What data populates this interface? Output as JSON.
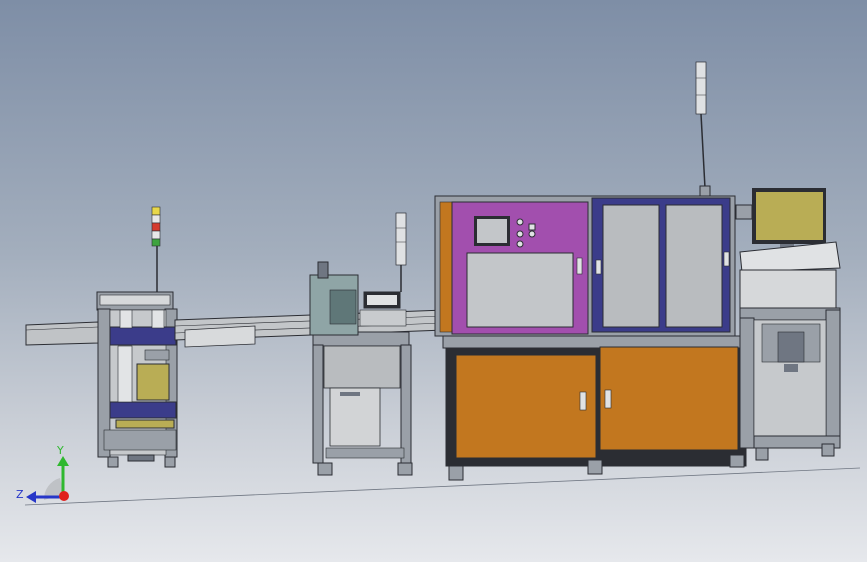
{
  "triad": {
    "x_label": "",
    "y_label": "Y",
    "z_label": "Z",
    "colors": {
      "x": "#e0201c",
      "y": "#2fb82f",
      "z": "#2636c8"
    }
  },
  "palette": {
    "frame": "#9aa0a8",
    "panel_gray": "#b9bcbf",
    "magenta": "#a24fae",
    "navy": "#3b3c8a",
    "orange": "#c2771f",
    "olive": "#b9ad55",
    "dark": "#2b2d33",
    "light": "#d6d8da"
  },
  "light_towers": [
    "left-tower",
    "mid-tower",
    "right-tower"
  ]
}
